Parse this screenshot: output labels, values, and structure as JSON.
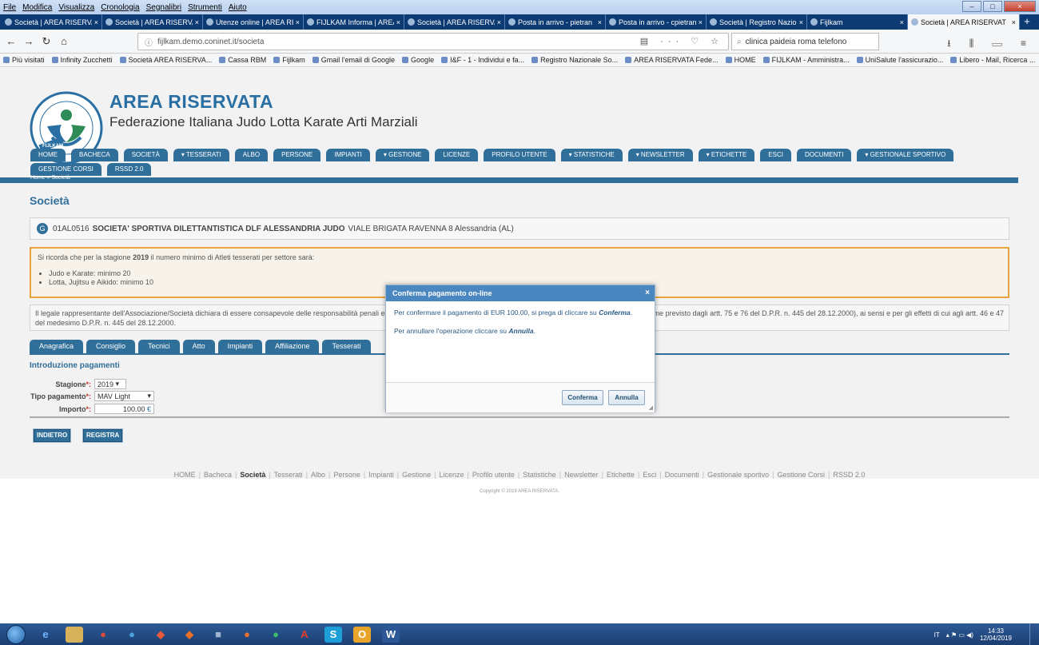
{
  "browser": {
    "menu": [
      "File",
      "Modifica",
      "Visualizza",
      "Cronologia",
      "Segnalibri",
      "Strumenti",
      "Aiuto"
    ],
    "tabs": [
      {
        "label": "Società | AREA RISERVAT",
        "active": false
      },
      {
        "label": "Società | AREA RISERVAT",
        "active": false
      },
      {
        "label": "Utenze online | AREA RI",
        "active": false
      },
      {
        "label": "FIJLKAM Informa | AREA",
        "active": false
      },
      {
        "label": "Società | AREA RISERVA",
        "active": false
      },
      {
        "label": "Posta in arrivo - pietran",
        "active": false
      },
      {
        "label": "Posta in arrivo - cpietran",
        "active": false
      },
      {
        "label": "Società | Registro Nazio",
        "active": false
      },
      {
        "label": "Fijlkam",
        "active": false
      },
      {
        "label": "Società | AREA RISERVAT",
        "active": true
      }
    ],
    "url": "fijlkam.demo.coninet.it/societa",
    "search": "clinica paideia roma telefono",
    "bookmarks": [
      "Più visitati",
      "Infinity Zucchetti",
      "Società AREA RISERVA...",
      "Cassa RBM",
      "Fijlkam",
      "Gmail l'email di Google",
      "Google",
      "I&F - 1 - Individui e fa...",
      "Registro Nazionale So...",
      "AREA RISERVATA Fede...",
      "HOME",
      "FIJLKAM - Amministra...",
      "UniSalute l'assicurazio...",
      "Libero - Mail, Ricerca ..."
    ]
  },
  "site": {
    "title": "AREA RISERVATA",
    "subtitle": "Federazione Italiana Judo Lotta Karate Arti Marziali",
    "logo_text": "FIJLKAM",
    "nav_row1": [
      "HOME",
      "BACHECA",
      "SOCIETÀ",
      "▾ TESSERATI",
      "ALBO",
      "PERSONE",
      "IMPIANTI",
      "▾ GESTIONE",
      "LICENZE",
      "PROFILO UTENTE",
      "▾ STATISTICHE",
      "▾ NEWSLETTER",
      "▾ ETICHETTE",
      "ESCI",
      "DOCUMENTI",
      "▾ GESTIONALE SPORTIVO"
    ],
    "nav_row2": [
      "GESTIONE CORSI",
      "RSSD 2.0"
    ],
    "breadcrumb": "Home » Società"
  },
  "page": {
    "title": "Società",
    "society": {
      "code": "01AL0516",
      "name": "SOCIETA' SPORTIVA DILETTANTISTICA DLF ALESSANDRIA JUDO",
      "address": "VIALE BRIGATA RAVENNA 8 Alessandria (AL)"
    },
    "notice": {
      "intro": "Si ricorda che per la stagione",
      "year": "2019",
      "rest": "il numero minimo di Atleti tesserati per settore sarà:",
      "items": [
        "Judo e Karate: minimo 20",
        "Lotta, Jujitsu e Aikido: minimo 10"
      ]
    },
    "legal_left": "Il legale rappresentante dell'Associazione/Società dichiara di essere consapevole delle responsabilità penali e de",
    "legal_right": "me previsto dagli artt. 75 e 76 del D.P.R. n. 445 del 28.12.2000), ai sensi e per gli effetti di cui agli artt. 46 e 47",
    "legal_line2": "del medesimo D.P.R. n. 445 del 28.12.2000.",
    "subtabs": [
      "Anagrafica",
      "Consiglio",
      "Tecnici",
      "Atto",
      "Impianti",
      "Affiliazione",
      "Tesserati"
    ],
    "form_title": "Introduzione pagamenti",
    "form": {
      "stagione_label": "Stagione",
      "stagione_value": "2019",
      "tipo_label": "Tipo pagamento",
      "tipo_value": "MAV Light",
      "importo_label": "Importo",
      "importo_value": "100.00",
      "currency": "€",
      "required_mark": "*:"
    },
    "buttons": {
      "back": "INDIETRO",
      "save": "REGISTRA"
    }
  },
  "dialog": {
    "title": "Conferma pagamento on-line",
    "close": "×",
    "line1_prefix": "Per confermare il pagamento di EUR 100.00, si prega di cliccare su",
    "line1_action": "Conferma",
    "line2_prefix": "Per annullare l'operazione cliccare su",
    "line2_action": "Annulla",
    "confirm_label": "Conferma",
    "cancel_label": "Annulla"
  },
  "footer": {
    "links": [
      "HOME",
      "Bacheca",
      "Società",
      "Tesserati",
      "Albo",
      "Persone",
      "Impianti",
      "Gestione",
      "Licenze",
      "Profilo utente",
      "Statistiche",
      "Newsletter",
      "Etichette",
      "Esci",
      "Documenti",
      "Gestionale sportivo",
      "Gestione Corsi",
      "RSSD 2.0"
    ],
    "active": "Società",
    "copyright": "Copyright © 2019 AREA RISERVATA."
  },
  "taskbar": {
    "language": "IT",
    "time": "14:33",
    "date": "12/04/2019"
  },
  "colors": {
    "primary": "#2f6f9a",
    "notice_border": "#e8a33d",
    "dialog_header": "#4a87c0"
  }
}
